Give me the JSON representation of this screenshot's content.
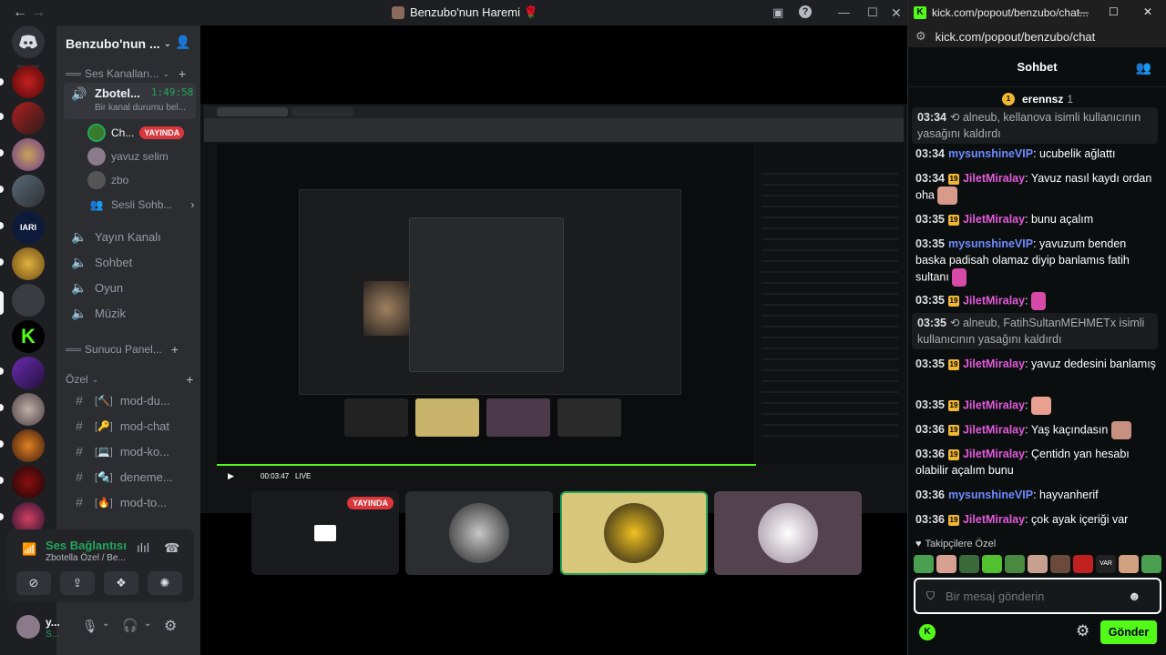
{
  "discord": {
    "window_title": "Benzubo'nun Haremi 🌹",
    "guild_name": "Benzubo'nun ...",
    "categories": {
      "voice": "Ses Kanalları...",
      "server_panel": "Sunucu Panel...",
      "private": "Özel"
    },
    "voice_channel": {
      "name": "Zbotel...",
      "timer": "1:49:58",
      "status": "Bir kanal durumu bel...",
      "users": [
        {
          "name": "Ch...",
          "badge": "YAYINDA"
        },
        {
          "name": "yavuz selim"
        },
        {
          "name": "zbo"
        }
      ],
      "sesli_sohbet": "Sesli Sohb..."
    },
    "channels": [
      {
        "name": "Yayın Kanalı",
        "icon": "speaker-icon"
      },
      {
        "name": "Sohbet",
        "icon": "speaker-icon"
      },
      {
        "name": "Oyun",
        "icon": "speaker-icon"
      },
      {
        "name": "Müzik",
        "icon": "speaker-icon"
      }
    ],
    "text_channels": [
      {
        "name": "mod-du...",
        "emoji": "🔨"
      },
      {
        "name": "mod-chat",
        "emoji": "🔑"
      },
      {
        "name": "mod-ko...",
        "emoji": "💻"
      },
      {
        "name": "deneme...",
        "emoji": "🔩"
      },
      {
        "name": "mod-to...",
        "emoji": "🔥"
      }
    ],
    "voice_connection": {
      "title": "Ses Bağlantısı K",
      "subtitle": "Zbotella Özel / Be..."
    },
    "user": {
      "name": "y...",
      "status": "S..."
    },
    "stream": {
      "live_badge": "YAYINDA",
      "player_time": "00:03:47",
      "player_live": "LIVE"
    }
  },
  "kick": {
    "tab_title": "kick.com/popout/benzubo/chat...",
    "url": "kick.com/popout/benzubo/chat",
    "chat_title": "Sohbet",
    "pinned_user": "erennsz",
    "pinned_count": "1",
    "messages": [
      {
        "time": "03:34",
        "system": true,
        "text": "alneub, kellanova isimli kullanıcının yasağını kaldırdı"
      },
      {
        "time": "03:34",
        "user": "mysunshineVIP",
        "color": "#6e8cff",
        "text": "ucubelik ağlattı"
      },
      {
        "time": "03:34",
        "user": "JiletMiralay",
        "color": "#e45adc",
        "text": "Yavuz nasıl kaydı ordan oha"
      },
      {
        "time": "03:35",
        "user": "JiletMiralay",
        "color": "#e45adc",
        "text": "bunu açalım"
      },
      {
        "time": "03:35",
        "user": "mysunshineVIP",
        "color": "#6e8cff",
        "text": "yavuzum benden baska padisah olamaz diyip banlamıs fatih sultanı"
      },
      {
        "time": "03:35",
        "user": "JiletMiralay",
        "color": "#e45adc",
        "text": ""
      },
      {
        "time": "03:35",
        "system": true,
        "text": "alneub, FatihSultanMEHMETx isimli kullanıcının yasağını kaldırdı"
      },
      {
        "time": "03:35",
        "user": "JiletMiralay",
        "color": "#e45adc",
        "text": "yavuz dedesini banlamış"
      },
      {
        "time": "03:35",
        "user": "JiletMiralay",
        "color": "#e45adc",
        "text": ""
      },
      {
        "time": "03:36",
        "user": "JiletMiralay",
        "color": "#e45adc",
        "text": "Yaş kaçındasın"
      },
      {
        "time": "03:36",
        "user": "JiletMiralay",
        "color": "#e45adc",
        "text": "Çentidn yan hesabı olabilir açalım bunu"
      },
      {
        "time": "03:36",
        "user": "mysunshineVIP",
        "color": "#6e8cff",
        "text": "hayvanherif"
      },
      {
        "time": "03:36",
        "user": "JiletMiralay",
        "color": "#e45adc",
        "text": "çok ayak içeriği var"
      }
    ],
    "followers_label": "Takipçilere Özel",
    "input_placeholder": "Bir mesaj gönderin",
    "send_label": "Gönder",
    "accent": "#53fc18"
  }
}
